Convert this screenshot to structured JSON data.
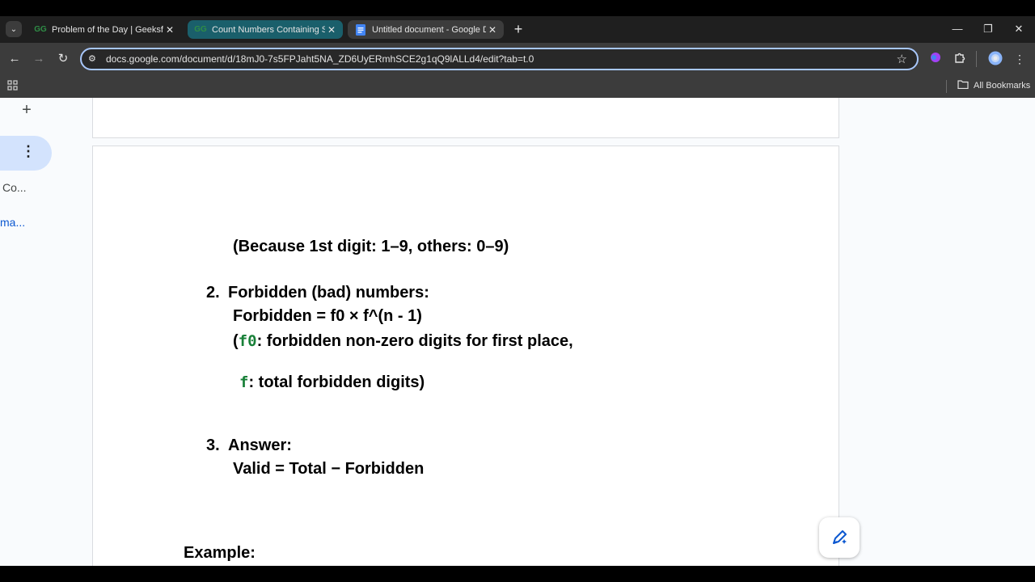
{
  "tabs": [
    {
      "title": "Problem of the Day | GeeksforG",
      "favicon": "gfg-icon"
    },
    {
      "title": "Count Numbers Containing Spe",
      "favicon": "gfg-icon"
    },
    {
      "title": "Untitled document - Google Do",
      "favicon": "docs-icon"
    }
  ],
  "toolbar": {
    "url": "docs.google.com/document/d/18mJ0-7s5FPJaht5NA_ZD6UyERmhSCE2g1qQ9lALLd4/edit?tab=t.0"
  },
  "bookmarks": {
    "all_bookmarks": "All Bookmarks"
  },
  "sidebar": {
    "item1": "Co...",
    "item2": "ma..."
  },
  "document": {
    "because_line": "(Because 1st digit: 1–9, others: 0–9)",
    "item2_number": "2.",
    "item2_heading": "Forbidden (bad) numbers:",
    "forbidden_formula": "Forbidden = f0 × f^(n - 1)",
    "f0_open": "(",
    "f0_code": "f0",
    "f0_desc": ": forbidden non-zero digits for first place,",
    "f_code": "f",
    "f_desc": ": total forbidden digits)",
    "item3_number": "3.",
    "item3_heading": "Answer:",
    "valid_formula": "Valid = Total − Forbidden",
    "example_heading": "Example:"
  },
  "colors": {
    "active_tab": "#1a5f6b",
    "code_green": "#188038",
    "omnibox_focus": "#a8c7fa"
  }
}
